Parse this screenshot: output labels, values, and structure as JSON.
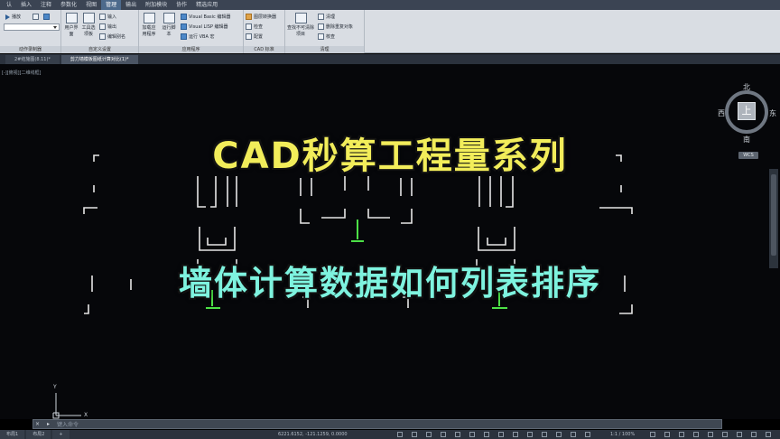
{
  "menubar": {
    "items": [
      "认",
      "插入",
      "注释",
      "参数化",
      "视图",
      "管理",
      "输出",
      "附加模块",
      "协作",
      "精选应用"
    ],
    "active_index": 5
  },
  "ribbon": {
    "panels": [
      {
        "title": "动作录制器",
        "buttons": [
          "播放"
        ]
      },
      {
        "title": "自定义设置",
        "big_buttons": [
          "用户界面",
          "工具选项板"
        ],
        "buttons": [
          "输入",
          "输出",
          "编辑别名"
        ]
      },
      {
        "title": "应用程序",
        "big_buttons": [
          "加载应用程序",
          "运行脚本"
        ],
        "buttons": [
          "Visual Basic 编辑器",
          "Visual LISP 编辑器",
          "运行 VBA 宏"
        ]
      },
      {
        "title": "CAD 标准",
        "buttons": [
          "图层转换器",
          "检查",
          "配置"
        ]
      },
      {
        "title": "清理",
        "big_buttons": [
          "查找不可清除项目"
        ],
        "buttons": [
          "清理",
          "删除重复对象",
          "核查"
        ]
      }
    ]
  },
  "doc_tabs": [
    "2#结施图(8.11)*",
    "剪力墙模板图纸计算对比(1)*"
  ],
  "canvas": {
    "view_label": "[-][俯视][二维线框]"
  },
  "titles": {
    "main": "CAD秒算工程量系列",
    "sub": "墙体计算数据如何列表排序"
  },
  "viewcube": {
    "north": "北",
    "south": "南",
    "west": "西",
    "east": "东",
    "face": "上",
    "wcs": "WCS"
  },
  "ucs": {
    "y": "Y",
    "x": "X"
  },
  "command_line": {
    "close": "×",
    "prompt": "▸",
    "placeholder": "键入命令"
  },
  "statusbar": {
    "layouts": [
      "布局1",
      "布局2",
      "+"
    ],
    "coords": "6221.6152, -121.1259, 0.0000",
    "scale": "1:1 / 100%"
  },
  "colors": {
    "main_title": "#f2ed5a",
    "sub_title": "#7ef3df",
    "drawing_lines": "#e6e6e6",
    "drawing_green": "#4ce046"
  }
}
